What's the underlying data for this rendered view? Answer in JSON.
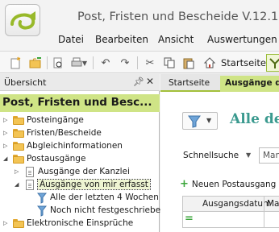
{
  "window": {
    "title": "Post, Fristen und Bescheide V.12.15"
  },
  "menu": [
    {
      "label": "Datei"
    },
    {
      "label": "Bearbeiten"
    },
    {
      "label": "Ansicht"
    },
    {
      "label": "Auswertungen"
    }
  ],
  "toolbar": {
    "icons": [
      "new-icon",
      "open-folder-icon",
      "print-preview-icon",
      "print-icon",
      "undo-icon",
      "redo-icon",
      "cut-icon",
      "copy-icon",
      "paste-icon",
      "home-icon",
      "tree-icon"
    ],
    "startseite_label": "Startseite"
  },
  "left_panel": {
    "title": "Übersicht",
    "heading": "Post, Fristen und Besc...",
    "tree": [
      {
        "label": "Posteingänge",
        "level": 0,
        "icon": "folder-icon",
        "expander": "collapsed"
      },
      {
        "label": "Fristen/Bescheide",
        "level": 0,
        "icon": "folder-icon",
        "expander": "collapsed"
      },
      {
        "label": "Abgleichinformationen",
        "level": 0,
        "icon": "folder-icon",
        "expander": "collapsed"
      },
      {
        "label": "Postausgänge",
        "level": 0,
        "icon": "folder-icon",
        "expander": "expanded"
      },
      {
        "label": "Ausgänge der Kanzlei",
        "level": 1,
        "icon": "document-icon",
        "expander": "collapsed"
      },
      {
        "label": "Ausgänge von mir erfasst",
        "level": 1,
        "icon": "document-icon",
        "expander": "expanded",
        "selected": true
      },
      {
        "label": "Alle der letzten 4 Wochen",
        "level": 2,
        "icon": "filter-icon"
      },
      {
        "label": "Noch nicht festgeschrieben",
        "level": 2,
        "icon": "filter-icon"
      },
      {
        "label": "Elektronische Einsprüche",
        "level": 0,
        "icon": "folder-icon",
        "expander": "collapsed"
      }
    ]
  },
  "right_panel": {
    "tabs": [
      {
        "label": "Startseite",
        "active": false
      },
      {
        "label": "Ausgänge d",
        "active": true
      }
    ],
    "view_title": "Alle de",
    "schnellsuche": {
      "label": "Schnellsuche",
      "placeholder": "Man"
    },
    "new_button_label": "Neuen Postausgang a",
    "grid_columns": [
      "Ausgangsdatum",
      "Ma"
    ],
    "filter_row_symbol": "="
  },
  "colors": {
    "accent_green": "#cfe486",
    "title_teal": "#3b9a8f",
    "folder_yellow": "#f3c454",
    "plus_green": "#3aa53a"
  }
}
